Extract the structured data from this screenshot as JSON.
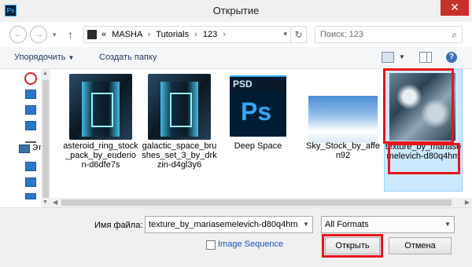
{
  "window": {
    "title": "Открытие",
    "app_icon_text": "Ps",
    "close_glyph": "✕"
  },
  "nav": {
    "back_glyph": "←",
    "forward_glyph": "→",
    "recent_glyph": "▾",
    "up_glyph": "↑",
    "breadcrumb_prefix": "«",
    "breadcrumb": [
      "MASHA",
      "Tutorials",
      "123"
    ],
    "breadcrumb_sep": "›",
    "refresh_glyph": "↻",
    "search_placeholder": "Поиск: 123",
    "search_glyph": "⌕"
  },
  "toolbar": {
    "organize_label": "Упорядочить",
    "new_folder_label": "Создать папку",
    "help_glyph": "?"
  },
  "sidebar": {
    "computer_label": "Эт"
  },
  "files": [
    {
      "name": "asteroid_ring_stock_pack_by_euderion-d6dfe7s",
      "kind": "folder"
    },
    {
      "name": "galactic_space_brushes_set_3_by_drkzin-d4gl3y6",
      "kind": "folder"
    },
    {
      "name": "Deep Space",
      "kind": "psd"
    },
    {
      "name": "Sky_Stock_by_affen92",
      "kind": "image"
    },
    {
      "name": "texture_by_mariasemelevich-d80q4hm",
      "kind": "image",
      "selected": true
    }
  ],
  "psd_thumb": {
    "header": "PSD",
    "logo": "Ps"
  },
  "footer": {
    "filename_label": "Имя файла:",
    "filename_value": "texture_by_mariasemelevich-d80q4hm",
    "filetype_value": "All Formats",
    "image_sequence_label": "Image Sequence",
    "open_label": "Открыть",
    "cancel_label": "Отмена"
  },
  "colors": {
    "highlight_red": "#e8141c",
    "selection_fill": "#cce8ff",
    "close_red": "#c7302b",
    "photoshop_blue": "#31a8ff"
  }
}
